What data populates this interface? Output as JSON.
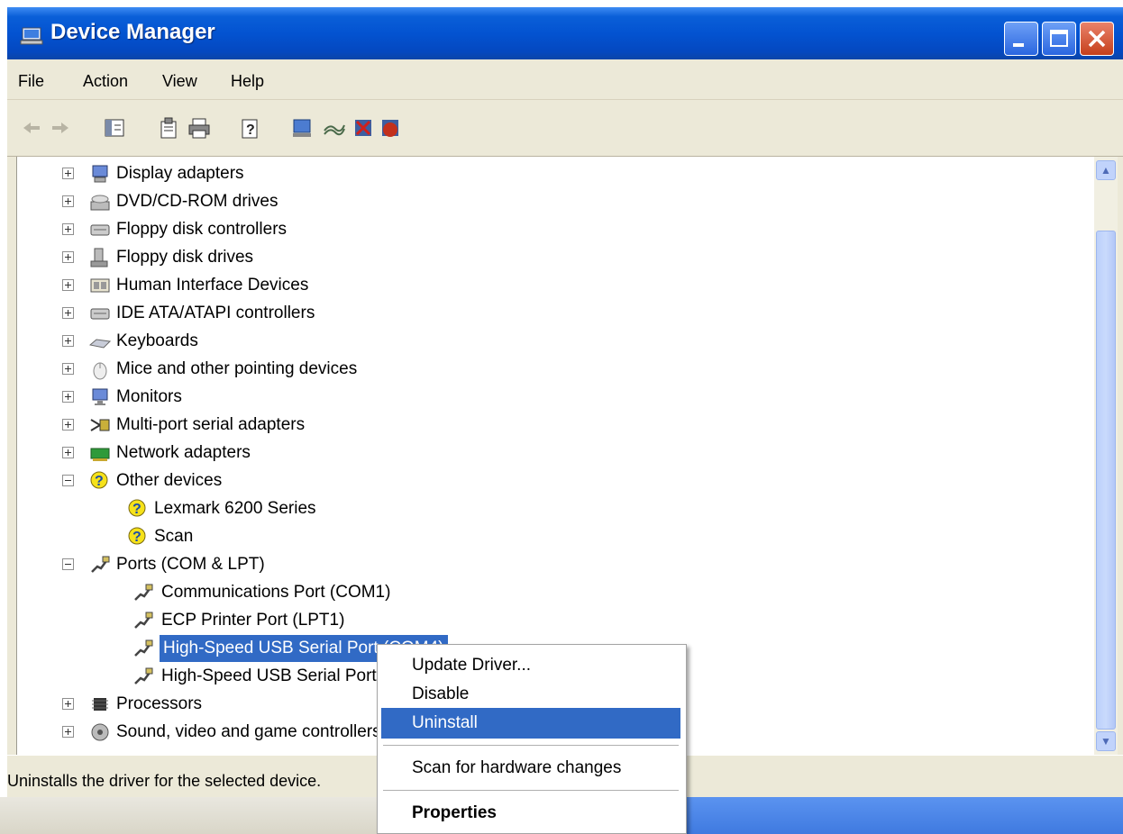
{
  "window": {
    "title": "Device Manager"
  },
  "menu": [
    "File",
    "Action",
    "View",
    "Help"
  ],
  "tree": [
    {
      "label": "Display adapters",
      "icon": "display-adapter-icon",
      "expander": "plus"
    },
    {
      "label": "DVD/CD-ROM drives",
      "icon": "cdrom-icon",
      "expander": "plus"
    },
    {
      "label": "Floppy disk controllers",
      "icon": "controller-icon",
      "expander": "plus"
    },
    {
      "label": "Floppy disk drives",
      "icon": "floppy-drive-icon",
      "expander": "plus"
    },
    {
      "label": "Human Interface Devices",
      "icon": "hid-icon",
      "expander": "plus"
    },
    {
      "label": "IDE ATA/ATAPI controllers",
      "icon": "ide-controller-icon",
      "expander": "plus"
    },
    {
      "label": "Keyboards",
      "icon": "keyboard-icon",
      "expander": "plus"
    },
    {
      "label": "Mice and other pointing devices",
      "icon": "mouse-icon",
      "expander": "plus"
    },
    {
      "label": "Monitors",
      "icon": "monitor-icon",
      "expander": "plus"
    },
    {
      "label": "Multi-port serial adapters",
      "icon": "serial-adapter-icon",
      "expander": "plus"
    },
    {
      "label": "Network adapters",
      "icon": "network-adapter-icon",
      "expander": "plus"
    },
    {
      "label": "Other devices",
      "icon": "unknown-device-icon",
      "expander": "minus"
    },
    {
      "label": "Lexmark 6200 Series",
      "icon": "unknown-device-icon",
      "child": true
    },
    {
      "label": "Scan",
      "icon": "unknown-device-warning-icon",
      "child": true
    },
    {
      "label": "Ports (COM & LPT)",
      "icon": "port-icon",
      "expander": "minus"
    },
    {
      "label": "Communications Port (COM1)",
      "icon": "port-icon",
      "child": true
    },
    {
      "label": "ECP Printer Port (LPT1)",
      "icon": "port-icon",
      "child": true
    },
    {
      "label": "High-Speed USB Serial Port (COM4)",
      "icon": "port-icon",
      "child": true,
      "selected": true
    },
    {
      "label": "High-Speed USB Serial Port (COM3)",
      "icon": "port-icon",
      "child": true
    },
    {
      "label": "Processors",
      "icon": "processor-icon",
      "expander": "plus"
    },
    {
      "label": "Sound, video and game controllers",
      "icon": "sound-icon",
      "expander": "plus"
    }
  ],
  "context_menu": {
    "items": [
      {
        "label": "Update Driver..."
      },
      {
        "label": "Disable"
      },
      {
        "label": "Uninstall",
        "highlighted": true
      },
      {
        "label": "Scan for hardware changes"
      },
      {
        "label": "Properties",
        "bold": true
      }
    ]
  },
  "status": {
    "text": "Uninstalls the driver for the selected device."
  },
  "colors": {
    "selection": "#316ac5",
    "titlebar": "#0353d1",
    "chrome": "#ece9d8"
  }
}
